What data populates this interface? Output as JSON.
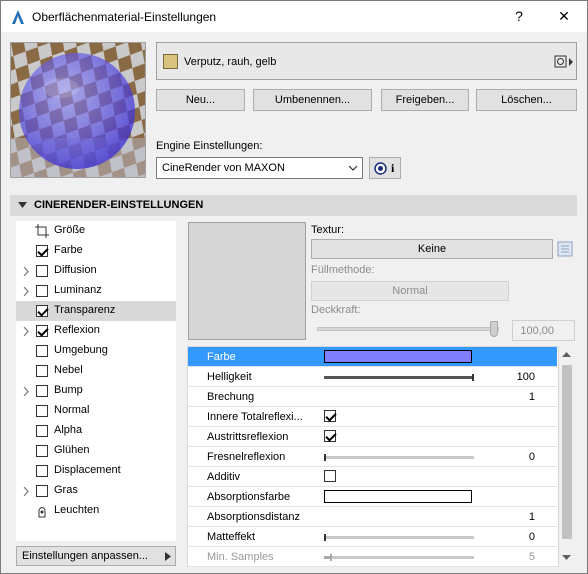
{
  "window": {
    "title": "Oberflächenmaterial-Einstellungen",
    "help": "?",
    "close": "✕"
  },
  "material": {
    "name": "Verputz, rauh, gelb",
    "swatch_color": "#d9c27e"
  },
  "buttons": {
    "new": "Neu...",
    "rename": "Umbenennen...",
    "share": "Freigeben...",
    "delete": "Löschen..."
  },
  "engine": {
    "label": "Engine Einstellungen:",
    "value": "CineRender von MAXON",
    "info": "i"
  },
  "section": {
    "title": "CINERENDER-EINSTELLUNGEN"
  },
  "tree": [
    {
      "label": "Größe",
      "checkbox": "none",
      "arrow": false,
      "icon": "size"
    },
    {
      "label": "Farbe",
      "checkbox": "checked",
      "arrow": false
    },
    {
      "label": "Diffusion",
      "checkbox": "unchecked",
      "arrow": true
    },
    {
      "label": "Luminanz",
      "checkbox": "unchecked",
      "arrow": true
    },
    {
      "label": "Transparenz",
      "checkbox": "checked",
      "arrow": false,
      "selected": true
    },
    {
      "label": "Reflexion",
      "checkbox": "checked",
      "arrow": true
    },
    {
      "label": "Umgebung",
      "checkbox": "unchecked",
      "arrow": false
    },
    {
      "label": "Nebel",
      "checkbox": "unchecked",
      "arrow": false
    },
    {
      "label": "Bump",
      "checkbox": "unchecked",
      "arrow": true
    },
    {
      "label": "Normal",
      "checkbox": "unchecked",
      "arrow": false
    },
    {
      "label": "Alpha",
      "checkbox": "unchecked",
      "arrow": false
    },
    {
      "label": "Glühen",
      "checkbox": "unchecked",
      "arrow": false
    },
    {
      "label": "Displacement",
      "checkbox": "unchecked",
      "arrow": false
    },
    {
      "label": "Gras",
      "checkbox": "unchecked",
      "arrow": true
    },
    {
      "label": "Leuchten",
      "checkbox": "none",
      "arrow": false,
      "icon": "lamp"
    }
  ],
  "customize_button": "Einstellungen anpassen...",
  "texture": {
    "label": "Textur:",
    "value": "Keine",
    "fill_label": "Füllmethode:",
    "fill_value": "Normal",
    "opacity_label": "Deckkraft:",
    "opacity_value": "100,00",
    "opacity_level": 1.0
  },
  "properties": [
    {
      "label": "Farbe",
      "type": "color",
      "color": "#8080ff",
      "selected": true
    },
    {
      "label": "Helligkeit",
      "type": "slider",
      "value": "100",
      "level": 1.0
    },
    {
      "label": "Brechung",
      "type": "number",
      "value": "1"
    },
    {
      "label": "Innere Totalreflexi...",
      "type": "checkbox",
      "checked": true
    },
    {
      "label": "Austrittsreflexion",
      "type": "checkbox",
      "checked": true
    },
    {
      "label": "Fresnelreflexion",
      "type": "slider",
      "value": "0",
      "level": 0.0
    },
    {
      "label": "Additiv",
      "type": "checkbox",
      "checked": false
    },
    {
      "label": "Absorptionsfarbe",
      "type": "color",
      "color": "#ffffff"
    },
    {
      "label": "Absorptionsdistanz",
      "type": "number",
      "value": "1"
    },
    {
      "label": "Matteffekt",
      "type": "slider",
      "value": "0",
      "level": 0.0
    },
    {
      "label": "Min. Samples",
      "type": "slider",
      "value": "5",
      "level": 0.05,
      "disabled": true
    }
  ]
}
